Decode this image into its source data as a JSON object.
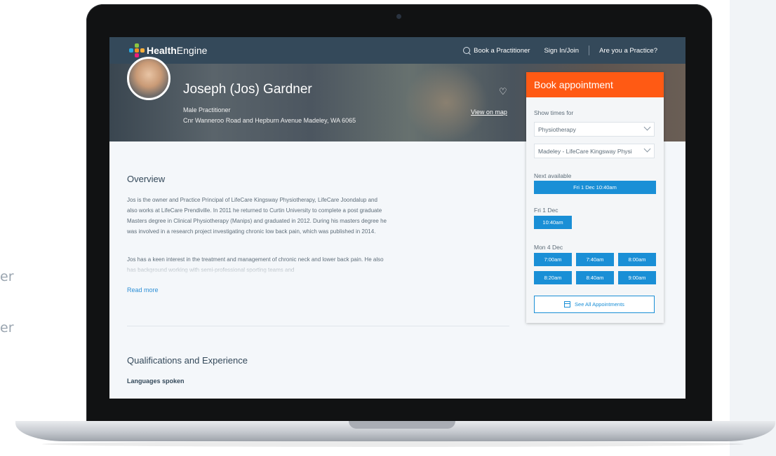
{
  "side_fragments": [
    "er",
    "er"
  ],
  "header": {
    "logo_text_bold": "Health",
    "logo_text_light": "Engine",
    "nav": {
      "book": "Book a Practitioner",
      "signin": "Sign In/Join",
      "practice": "Are you a Practice?"
    }
  },
  "profile": {
    "name": "Joseph (Jos) Gardner",
    "role": "Male Practitioner",
    "address": "Cnr Wanneroo Road and Hepburn Avenue Madeley, WA 6065",
    "map_link": "View on map"
  },
  "overview": {
    "title": "Overview",
    "paragraph1": "Jos is the owner and Practice Principal of LifeCare Kingsway Physiotherapy, LifeCare Joondalup and also works at LifeCare Prendiville. In 2011 he returned to Curtin University to complete a post graduate Masters degree in Clinical Physiotherapy (Manips) and graduated in 2012. During his masters degree he was involved in a research project investigating chronic low back pain, which was published in 2014.",
    "paragraph2": "Jos has a keen interest in the treatment and management of chronic neck and lower back pain. He also has background working with semi-professional sporting teams and",
    "read_more": "Read more"
  },
  "qualifications": {
    "title": "Qualifications and Experience",
    "languages_label": "Languages spoken"
  },
  "booking": {
    "title": "Book appointment",
    "show_label": "Show times for",
    "service": "Physiotherapy",
    "location": "Madeley - LifeCare Kingsway Physi",
    "next_label": "Next available",
    "next_slot": "Fri 1 Dec 10:40am",
    "day1_label": "Fri 1 Dec",
    "day1_slots": [
      "10:40am"
    ],
    "day2_label": "Mon 4 Dec",
    "day2_slots": [
      "7:00am",
      "7:40am",
      "8:00am",
      "8:20am",
      "8:40am",
      "9:00am"
    ],
    "see_all": "See All Appointments"
  },
  "colors": {
    "navbar": "#34495a",
    "accent_orange": "#ff5a14",
    "slot_blue": "#1a8fd6"
  }
}
